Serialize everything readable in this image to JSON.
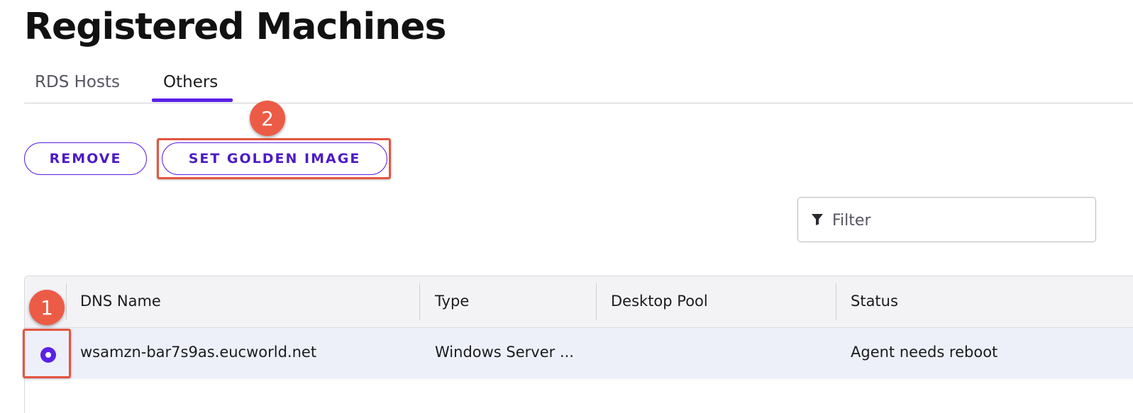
{
  "page": {
    "title": "Registered Machines"
  },
  "tabs": [
    {
      "label": "RDS Hosts",
      "selected": false
    },
    {
      "label": "Others",
      "selected": true
    }
  ],
  "actions": {
    "remove_label": "REMOVE",
    "set_golden_image_label": "SET GOLDEN IMAGE"
  },
  "filter": {
    "placeholder": "Filter",
    "value": "",
    "icon": "filter-funnel-icon"
  },
  "table": {
    "columns": [
      "DNS Name",
      "Type",
      "Desktop Pool",
      "Status"
    ],
    "rows": [
      {
        "selected": true,
        "dns_name": "wsamzn-bar7s9as.eucworld.net",
        "type": "Windows Server ...",
        "desktop_pool": "",
        "status": "Agent needs reboot"
      }
    ]
  },
  "callouts": [
    {
      "number": "1",
      "target": "row-select-radio"
    },
    {
      "number": "2",
      "target": "set-golden-image-button"
    }
  ],
  "colors": {
    "accent": "#5b21e6",
    "callout": "#ec5b45",
    "row_selected_bg": "#eef0f9"
  }
}
